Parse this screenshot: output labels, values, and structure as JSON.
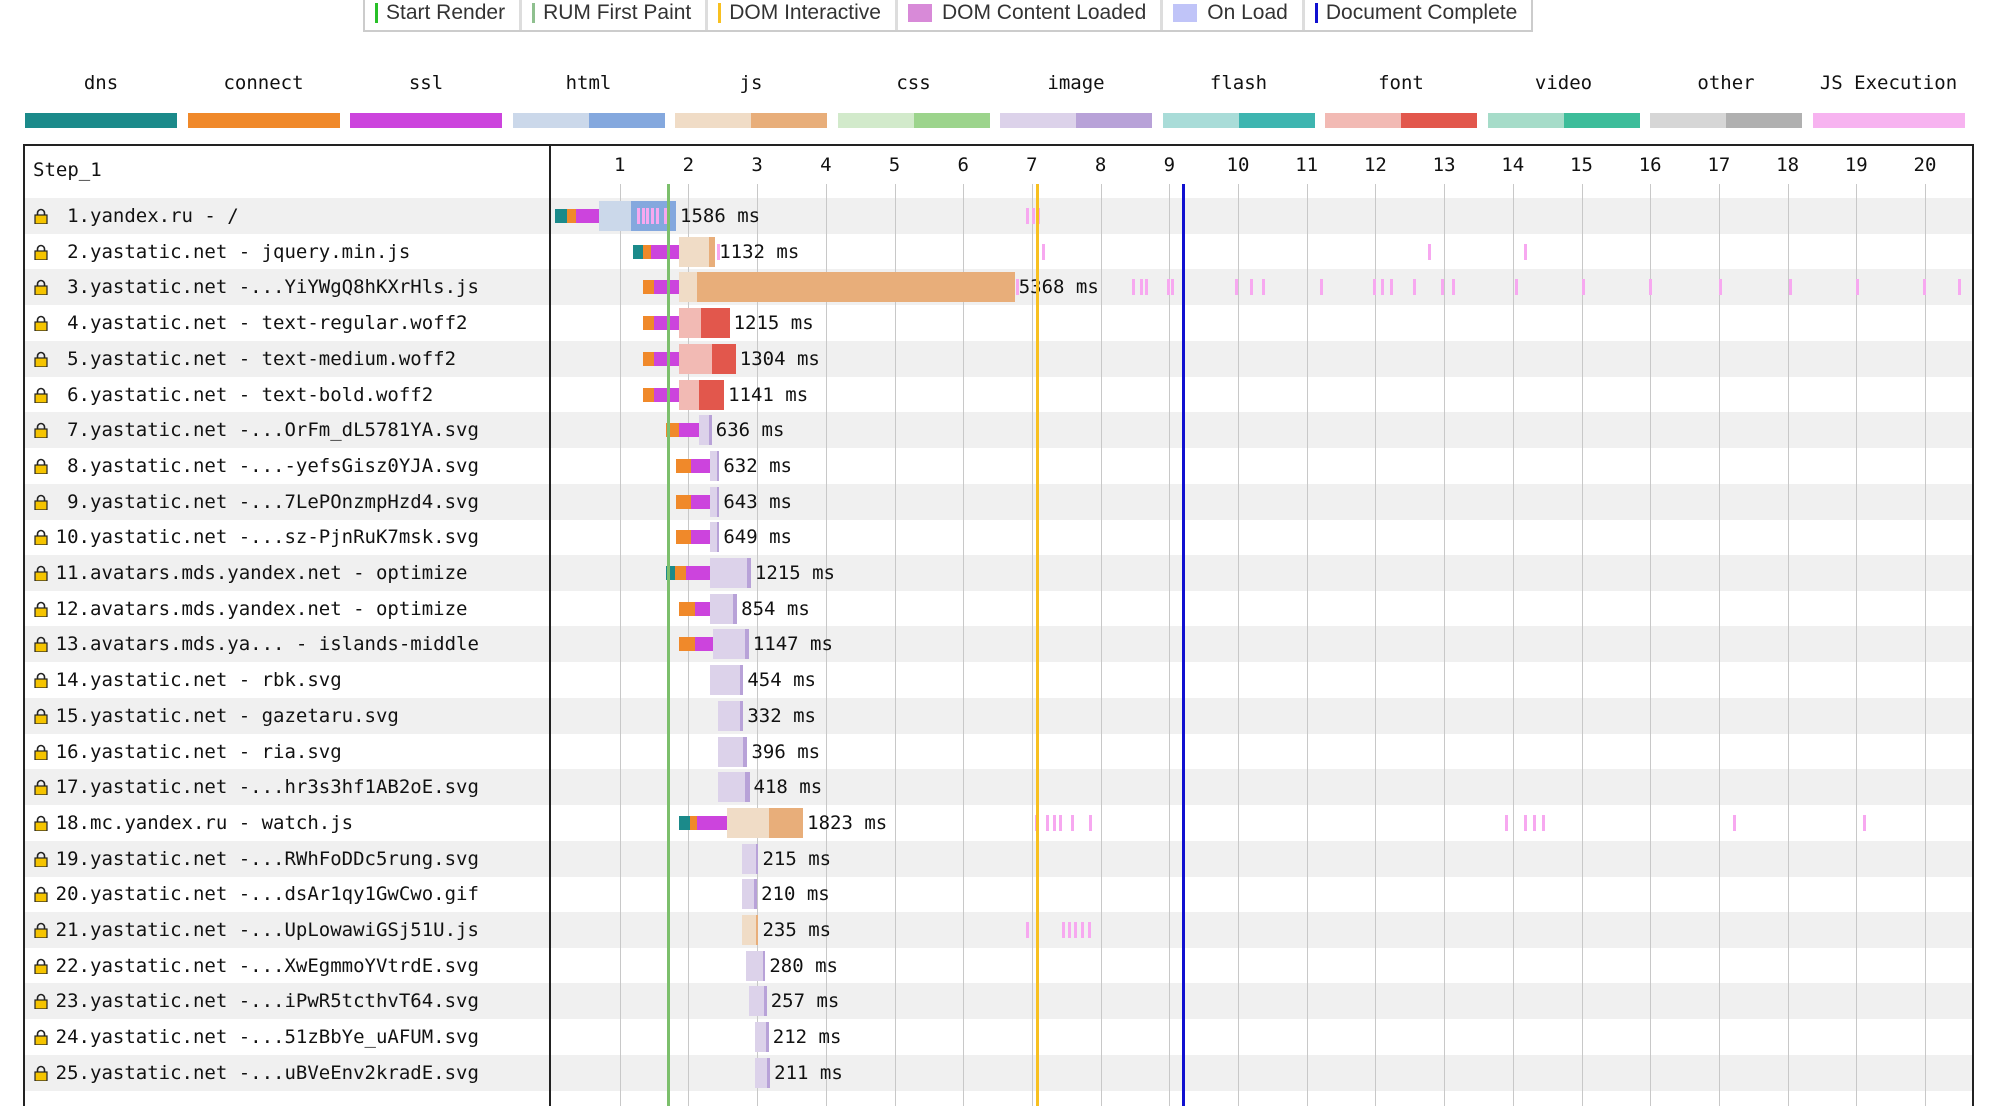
{
  "top_legend": [
    {
      "label": "Start Render",
      "color": "#28c028",
      "kind": "line"
    },
    {
      "label": "RUM First Paint",
      "color": "#8fc08f",
      "kind": "line"
    },
    {
      "label": "DOM Interactive",
      "color": "#f8c020",
      "kind": "line"
    },
    {
      "label": "DOM Content Loaded",
      "color": "#d88ad8",
      "kind": "box"
    },
    {
      "label": "On Load",
      "color": "#c0c4f8",
      "kind": "box"
    },
    {
      "label": "Document Complete",
      "color": "#1010d0",
      "kind": "line"
    }
  ],
  "type_legend": [
    {
      "label": "dns",
      "colors": [
        "#1b8a8a"
      ]
    },
    {
      "label": "connect",
      "colors": [
        "#f0892a"
      ]
    },
    {
      "label": "ssl",
      "colors": [
        "#cc44dd"
      ]
    },
    {
      "label": "html",
      "colors": [
        "#cbd8ea",
        "#84a8de"
      ]
    },
    {
      "label": "js",
      "colors": [
        "#f0dcc6",
        "#e8ae7a"
      ]
    },
    {
      "label": "css",
      "colors": [
        "#d2eacb",
        "#9cd48c"
      ]
    },
    {
      "label": "image",
      "colors": [
        "#dcd2ea",
        "#b8a2d8"
      ]
    },
    {
      "label": "flash",
      "colors": [
        "#a9dcd8",
        "#3eb5b0"
      ]
    },
    {
      "label": "font",
      "colors": [
        "#f2bab4",
        "#e2574c"
      ]
    },
    {
      "label": "video",
      "colors": [
        "#a6dcc9",
        "#3dbd9a"
      ]
    },
    {
      "label": "other",
      "colors": [
        "#d6d6d6",
        "#b0b0b0"
      ]
    },
    {
      "label": "JS Execution",
      "colors": [
        "#f7b3f0"
      ]
    }
  ],
  "step_label": "Step_1",
  "timeline": {
    "unit": "s",
    "ticks": [
      1,
      2,
      3,
      4,
      5,
      6,
      7,
      8,
      9,
      10,
      11,
      12,
      13,
      14,
      15,
      16,
      17,
      18,
      19,
      20
    ],
    "max": 20.6
  },
  "markers": [
    {
      "name": "start-render",
      "time": 1.71,
      "color": "#7cbf6c"
    },
    {
      "name": "dom-interactive",
      "time": 7.07,
      "color": "#f8c020"
    },
    {
      "name": "document-complete",
      "time": 9.2,
      "color": "#1010d0"
    }
  ],
  "requests": [
    {
      "num": "1.",
      "label": "yandex.ru - /",
      "type": "html",
      "start": 0.06,
      "dns": 0.24,
      "connect": 0.37,
      "ssl": 0.7,
      "ttfb": 1.17,
      "end": 1.82,
      "duration": "1586 ms",
      "js": [
        1.25,
        1.32,
        1.39,
        1.46,
        1.53,
        1.65,
        6.92,
        7.0,
        7.08
      ]
    },
    {
      "num": "2.",
      "label": "yastatic.net - jquery.min.js",
      "type": "js",
      "start": 1.19,
      "dns": 1.34,
      "connect": 1.45,
      "ssl": 1.86,
      "ttfb": 2.3,
      "end": 2.39,
      "duration": "1132 ms",
      "js": [
        2.41,
        7.14,
        12.76,
        14.16
      ]
    },
    {
      "num": "3.",
      "label": "yastatic.net -...YiYWgQ8hKXrHls.js",
      "type": "js",
      "start": 1.34,
      "dns": null,
      "connect": 1.5,
      "ssl": 1.86,
      "ttfb": 2.12,
      "end": 6.75,
      "duration": "5368 ms",
      "js": [
        6.77,
        8.46,
        8.57,
        8.65,
        8.96,
        9.03,
        9.96,
        10.17,
        10.35,
        11.19,
        11.97,
        12.08,
        12.21,
        12.55,
        12.96,
        13.11,
        14.03,
        15.01,
        15.98,
        17.0,
        18.02,
        19.0,
        19.97,
        20.48
      ]
    },
    {
      "num": "4.",
      "label": "yastatic.net - text-regular.woff2",
      "type": "font",
      "start": 1.34,
      "dns": null,
      "connect": 1.5,
      "ssl": 1.86,
      "ttfb": 2.19,
      "end": 2.6,
      "duration": "1215 ms",
      "js": []
    },
    {
      "num": "5.",
      "label": "yastatic.net - text-medium.woff2",
      "type": "font",
      "start": 1.34,
      "dns": null,
      "connect": 1.5,
      "ssl": 1.86,
      "ttfb": 2.34,
      "end": 2.69,
      "duration": "1304 ms",
      "js": []
    },
    {
      "num": "6.",
      "label": "yastatic.net - text-bold.woff2",
      "type": "font",
      "start": 1.34,
      "dns": null,
      "connect": 1.5,
      "ssl": 1.86,
      "ttfb": 2.15,
      "end": 2.52,
      "duration": "1141 ms",
      "js": []
    },
    {
      "num": "7.",
      "label": "yastatic.net -...OrFm_dL5781YA.svg",
      "type": "image",
      "start": 1.67,
      "dns": null,
      "connect": 1.87,
      "ssl": 2.15,
      "ttfb": 2.3,
      "end": 2.34,
      "duration": "636 ms",
      "js": []
    },
    {
      "num": "8.",
      "label": "yastatic.net -...-yefsGisz0YJA.svg",
      "type": "image",
      "start": 1.82,
      "dns": null,
      "connect": 2.04,
      "ssl": 2.32,
      "ttfb": 2.42,
      "end": 2.45,
      "duration": "632 ms",
      "js": []
    },
    {
      "num": "9.",
      "label": "yastatic.net -...7LePOnzmpHzd4.svg",
      "type": "image",
      "start": 1.82,
      "dns": null,
      "connect": 2.04,
      "ssl": 2.32,
      "ttfb": 2.42,
      "end": 2.45,
      "duration": "643 ms",
      "js": []
    },
    {
      "num": "10.",
      "label": "yastatic.net -...sz-PjnRuK7msk.svg",
      "type": "image",
      "start": 1.82,
      "dns": null,
      "connect": 2.04,
      "ssl": 2.32,
      "ttfb": 2.42,
      "end": 2.45,
      "duration": "649 ms",
      "js": []
    },
    {
      "num": "11.",
      "label": "avatars.mds.yandex.net - optimize",
      "type": "image",
      "start": 1.67,
      "dns": 1.8,
      "connect": 1.97,
      "ssl": 2.32,
      "ttfb": 2.85,
      "end": 2.91,
      "duration": "1215 ms",
      "js": []
    },
    {
      "num": "12.",
      "label": "avatars.mds.yandex.net - optimize",
      "type": "image",
      "start": 1.86,
      "dns": null,
      "connect": 2.1,
      "ssl": 2.32,
      "ttfb": 2.65,
      "end": 2.71,
      "duration": "854 ms",
      "js": []
    },
    {
      "num": "13.",
      "label": "avatars.mds.ya... - islands-middle",
      "type": "image",
      "start": 1.86,
      "dns": null,
      "connect": 2.1,
      "ssl": 2.36,
      "ttfb": 2.82,
      "end": 2.88,
      "duration": "1147 ms",
      "js": []
    },
    {
      "num": "14.",
      "label": "yastatic.net - rbk.svg",
      "type": "image",
      "start": 2.32,
      "dns": null,
      "connect": null,
      "ssl": null,
      "ttfb": 2.75,
      "end": 2.8,
      "duration": "454 ms",
      "js": []
    },
    {
      "num": "15.",
      "label": "yastatic.net - gazetaru.svg",
      "type": "image",
      "start": 2.43,
      "dns": null,
      "connect": null,
      "ssl": null,
      "ttfb": 2.75,
      "end": 2.8,
      "duration": "332 ms",
      "js": []
    },
    {
      "num": "16.",
      "label": "yastatic.net - ria.svg",
      "type": "image",
      "start": 2.43,
      "dns": null,
      "connect": null,
      "ssl": null,
      "ttfb": 2.8,
      "end": 2.86,
      "duration": "396 ms",
      "js": []
    },
    {
      "num": "17.",
      "label": "yastatic.net -...hr3s3hf1AB2oE.svg",
      "type": "image",
      "start": 2.43,
      "dns": null,
      "connect": null,
      "ssl": null,
      "ttfb": 2.83,
      "end": 2.89,
      "duration": "418 ms",
      "js": []
    },
    {
      "num": "18.",
      "label": "mc.yandex.ru - watch.js",
      "type": "js",
      "start": 1.86,
      "dns": 2.02,
      "connect": 2.12,
      "ssl": 2.56,
      "ttfb": 3.17,
      "end": 3.67,
      "duration": "1823 ms",
      "js": [
        7.05,
        7.2,
        7.3,
        7.4,
        7.57,
        7.83,
        13.88,
        14.16,
        14.3,
        14.43,
        17.2,
        19.1
      ]
    },
    {
      "num": "19.",
      "label": "yastatic.net -...RWhFoDDc5rung.svg",
      "type": "image",
      "start": 2.78,
      "dns": null,
      "connect": null,
      "ssl": null,
      "ttfb": 2.98,
      "end": 3.02,
      "duration": "215 ms",
      "js": []
    },
    {
      "num": "20.",
      "label": "yastatic.net -...dsAr1qy1GwCwo.gif",
      "type": "image",
      "start": 2.78,
      "dns": null,
      "connect": null,
      "ssl": null,
      "ttfb": 2.96,
      "end": 3.0,
      "duration": "210 ms",
      "js": []
    },
    {
      "num": "21.",
      "label": "yastatic.net -...UpLowawiGSj51U.js",
      "type": "js",
      "start": 2.78,
      "dns": null,
      "connect": null,
      "ssl": null,
      "ttfb": 2.98,
      "end": 3.02,
      "duration": "235 ms",
      "js": [
        6.92,
        7.44,
        7.53,
        7.62,
        7.72,
        7.81
      ]
    },
    {
      "num": "22.",
      "label": "yastatic.net -...XwEgmmoYVtrdE.svg",
      "type": "image",
      "start": 2.84,
      "dns": null,
      "connect": null,
      "ssl": null,
      "ttfb": 3.08,
      "end": 3.12,
      "duration": "280 ms",
      "js": []
    },
    {
      "num": "23.",
      "label": "yastatic.net -...iPwR5tcthvT64.svg",
      "type": "image",
      "start": 2.88,
      "dns": null,
      "connect": null,
      "ssl": null,
      "ttfb": 3.1,
      "end": 3.14,
      "duration": "257 ms",
      "js": []
    },
    {
      "num": "24.",
      "label": "yastatic.net -...51zBbYe_uAFUM.svg",
      "type": "image",
      "start": 2.97,
      "dns": null,
      "connect": null,
      "ssl": null,
      "ttfb": 3.13,
      "end": 3.17,
      "duration": "212 ms",
      "js": []
    },
    {
      "num": "25.",
      "label": "yastatic.net -...uBVeEnv2kradE.svg",
      "type": "image",
      "start": 2.97,
      "dns": null,
      "connect": null,
      "ssl": null,
      "ttfb": 3.14,
      "end": 3.19,
      "duration": "211 ms",
      "js": []
    }
  ]
}
